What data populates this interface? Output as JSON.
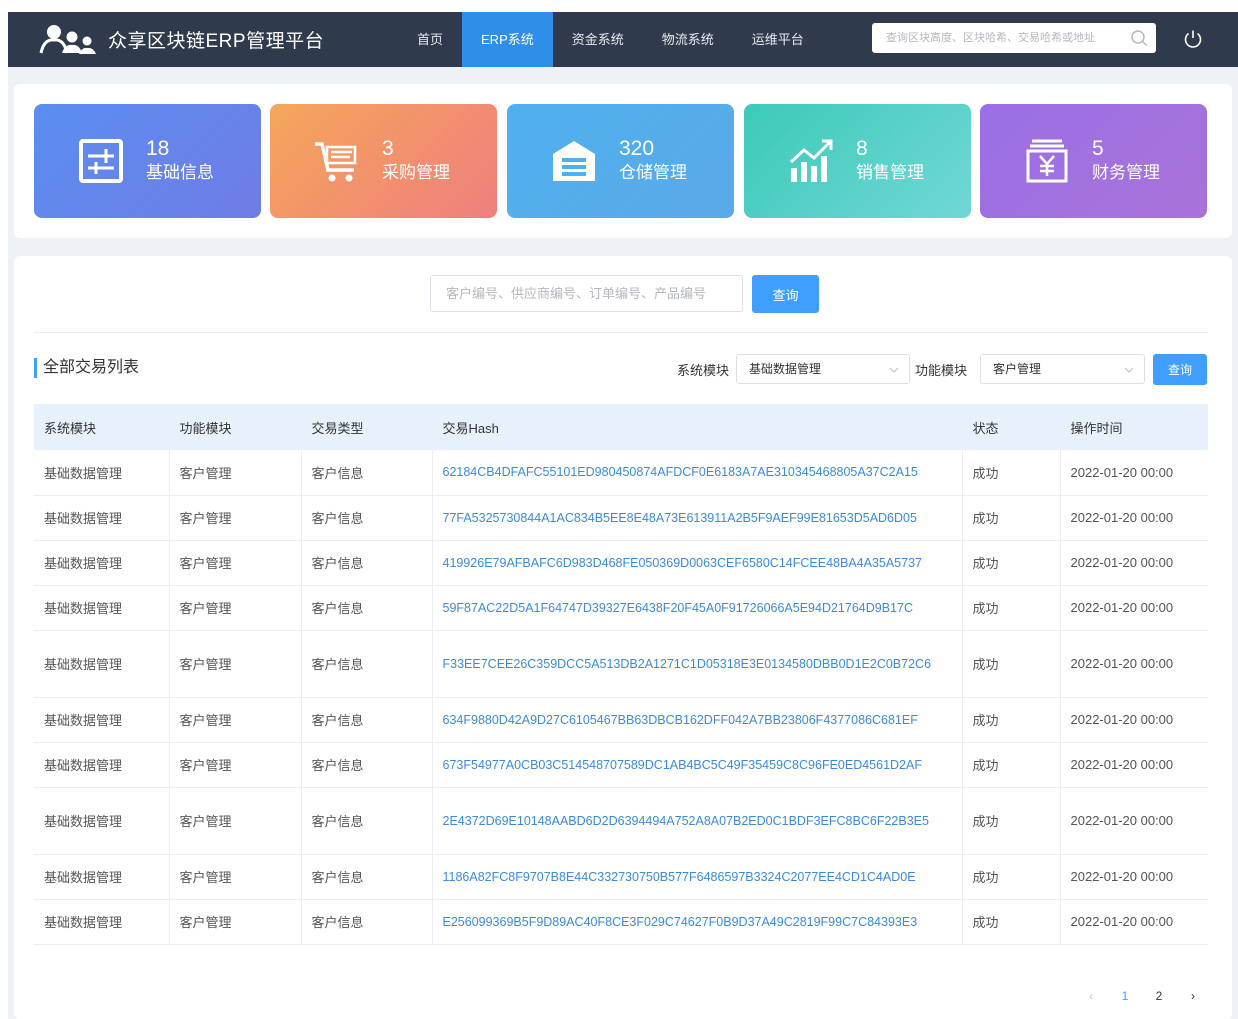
{
  "header": {
    "title": "众享区块链ERP管理平台",
    "nav": [
      {
        "label": "首页",
        "active": false
      },
      {
        "label": "ERP系统",
        "active": true
      },
      {
        "label": "资金系统",
        "active": false
      },
      {
        "label": "物流系统",
        "active": false
      },
      {
        "label": "运维平台",
        "active": false
      }
    ],
    "search_placeholder": "查询区块高度、区块哈希、交易哈希或地址"
  },
  "cards": [
    {
      "count": "18",
      "label": "基础信息",
      "icon": "calculator-icon"
    },
    {
      "count": "3",
      "label": "采购管理",
      "icon": "cart-icon"
    },
    {
      "count": "320",
      "label": "仓储管理",
      "icon": "warehouse-icon"
    },
    {
      "count": "8",
      "label": "销售管理",
      "icon": "sales-chart-icon"
    },
    {
      "count": "5",
      "label": "财务管理",
      "icon": "yen-icon"
    }
  ],
  "query": {
    "placeholder": "客户编号、供应商编号、订单编号、产品编号",
    "button": "查询"
  },
  "list": {
    "title": "全部交易列表",
    "system_label": "系统模块",
    "system_value": "基础数据管理",
    "function_label": "功能模块",
    "function_value": "客户管理",
    "button": "查询"
  },
  "table": {
    "headers": [
      "系统模块",
      "功能模块",
      "交易类型",
      "交易Hash",
      "状态",
      "操作时间"
    ],
    "rows": [
      {
        "sys": "基础数据管理",
        "fn": "客户管理",
        "type": "客户信息",
        "hash": "62184CB4DFAFC55101ED980450874AFDCF0E6183A7AE310345468805A37C2A15",
        "status": "成功",
        "time": "2022-01-20 00:00"
      },
      {
        "sys": "基础数据管理",
        "fn": "客户管理",
        "type": "客户信息",
        "hash": "77FA5325730844A1AC834B5EE8E48A73E613911A2B5F9AEF99E81653D5AD6D05",
        "status": "成功",
        "time": "2022-01-20 00:00"
      },
      {
        "sys": "基础数据管理",
        "fn": "客户管理",
        "type": "客户信息",
        "hash": "419926E79AFBAFC6D983D468FE050369D0063CEF6580C14FCEE48BA4A35A5737",
        "status": "成功",
        "time": "2022-01-20 00:00"
      },
      {
        "sys": "基础数据管理",
        "fn": "客户管理",
        "type": "客户信息",
        "hash": "59F87AC22D5A1F64747D39327E6438F20F45A0F91726066A5E94D21764D9B17C",
        "status": "成功",
        "time": "2022-01-20 00:00"
      },
      {
        "sys": "基础数据管理",
        "fn": "客户管理",
        "type": "客户信息",
        "hash": "F33EE7CEE26C359DCC5A513DB2A1271C1D05318E3E0134580DBB0D1E2C0B72C6",
        "status": "成功",
        "time": "2022-01-20 00:00"
      },
      {
        "sys": "基础数据管理",
        "fn": "客户管理",
        "type": "客户信息",
        "hash": "634F9880D42A9D27C6105467BB63DBCB162DFF042A7BB23806F4377086C681EF",
        "status": "成功",
        "time": "2022-01-20 00:00"
      },
      {
        "sys": "基础数据管理",
        "fn": "客户管理",
        "type": "客户信息",
        "hash": "673F54977A0CB03C514548707589DC1AB4BC5C49F35459C8C96FE0ED4561D2AF",
        "status": "成功",
        "time": "2022-01-20 00:00"
      },
      {
        "sys": "基础数据管理",
        "fn": "客户管理",
        "type": "客户信息",
        "hash": "2E4372D69E10148AABD6D2D6394494A752A8A07B2ED0C1BDF3EFC8BC6F22B3E5",
        "status": "成功",
        "time": "2022-01-20 00:00"
      },
      {
        "sys": "基础数据管理",
        "fn": "客户管理",
        "type": "客户信息",
        "hash": "1186A82FC8F9707B8E44C332730750B577F6486597B3324C2077EE4CD1C4AD0E",
        "status": "成功",
        "time": "2022-01-20 00:00"
      },
      {
        "sys": "基础数据管理",
        "fn": "客户管理",
        "type": "客户信息",
        "hash": "E256099369B5F9D89AC40F8CE3F029C74627F0B9D37A49C2819F99C7C84393E3",
        "status": "成功",
        "time": "2022-01-20 00:00"
      }
    ]
  },
  "pagination": {
    "prev": "‹",
    "pages": [
      "1",
      "2"
    ],
    "current": "1",
    "next": "›"
  },
  "colors": {
    "header_bg": "#2f3b4c",
    "accent": "#409eff",
    "hash_link": "#3b8bdc",
    "table_header_bg": "#e6f1fc"
  }
}
